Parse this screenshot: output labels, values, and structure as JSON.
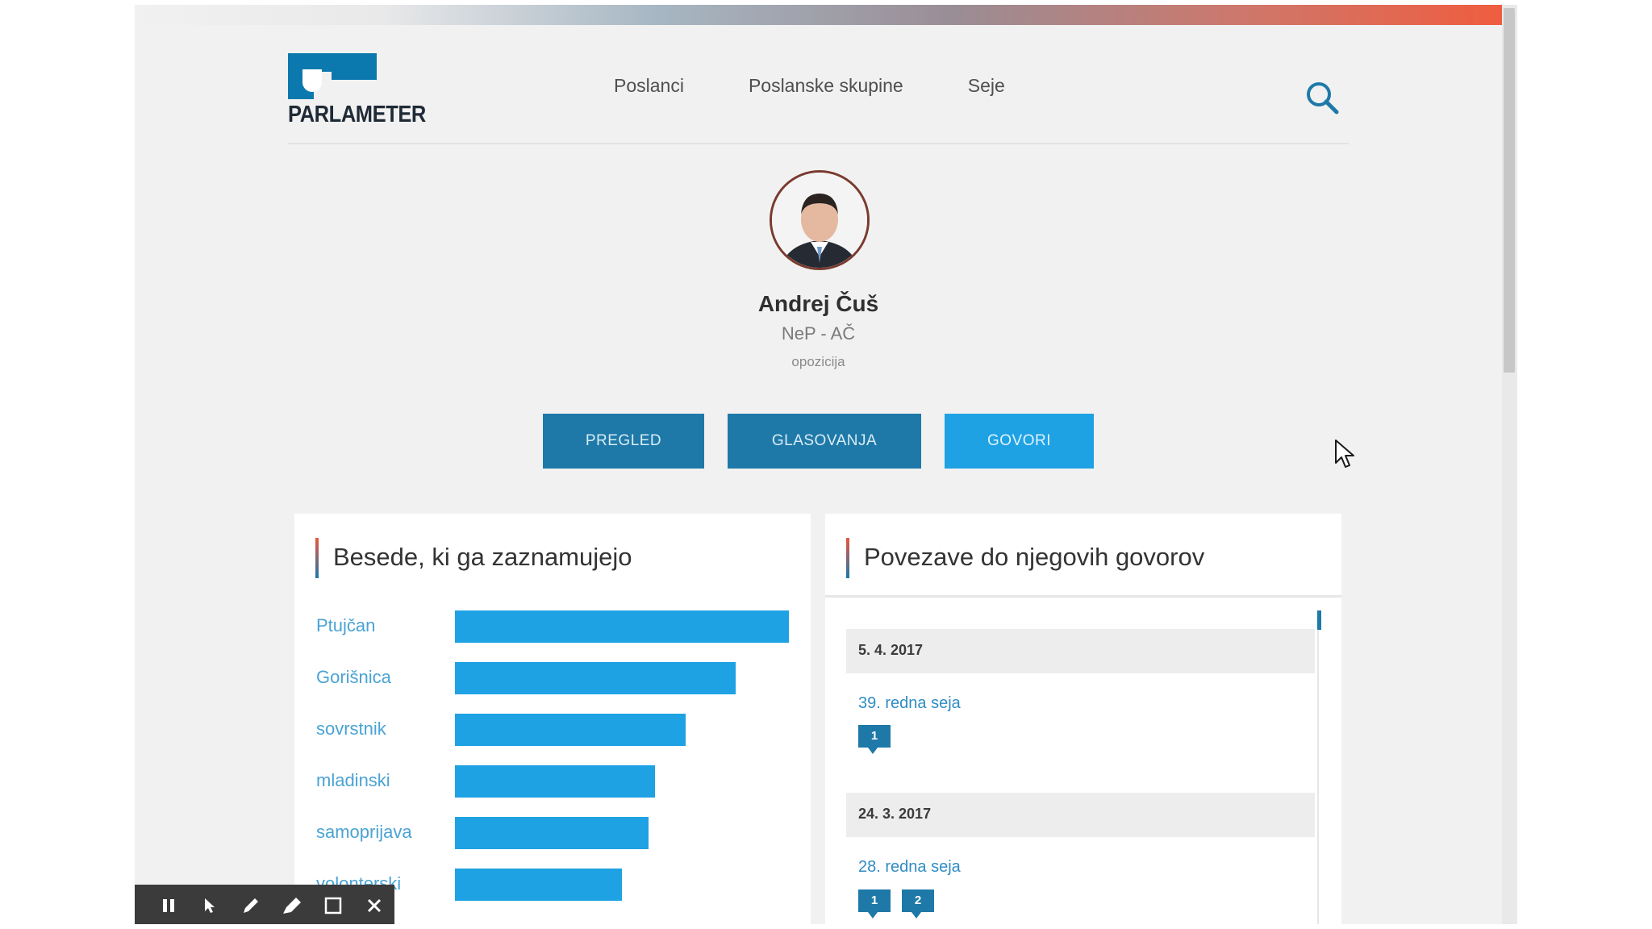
{
  "logo": {
    "text": "PARLAMETER"
  },
  "nav": {
    "items": [
      "Poslanci",
      "Poslanske skupine",
      "Seje"
    ]
  },
  "profile": {
    "name": "Andrej Čuš",
    "party": "NeP - AČ",
    "status": "opozicija"
  },
  "tabs": {
    "pregled": "PREGLED",
    "glasovanja": "GLASOVANJA",
    "govori": "GOVORI",
    "active": "GOVORI"
  },
  "words_card": {
    "title": "Besede, ki ga zaznamujejo",
    "items": [
      {
        "word": "Ptujčan",
        "value": 1.0
      },
      {
        "word": "Gorišnica",
        "value": 0.84
      },
      {
        "word": "sovrstnik",
        "value": 0.69
      },
      {
        "word": "mladinski",
        "value": 0.6
      },
      {
        "word": "samoprijava",
        "value": 0.58
      },
      {
        "word": "volonterski",
        "value": 0.5
      }
    ]
  },
  "links_card": {
    "title": "Povezave do njegovih govorov",
    "entries": [
      {
        "date": "5. 4. 2017",
        "session": "39. redna seja",
        "speeches": [
          "1"
        ]
      },
      {
        "date": "24. 3. 2017",
        "session": "28. redna seja",
        "speeches": [
          "1",
          "2"
        ]
      }
    ]
  },
  "colors": {
    "primary": "#1e79a8",
    "active_tab": "#1ea2e3",
    "accent": "#e9573f",
    "bar": "#1ea2e3"
  },
  "icons": [
    "search-icon",
    "pause-icon",
    "pointer-icon",
    "pen-icon",
    "marker-icon",
    "square-icon",
    "close-icon",
    "cursor-icon"
  ]
}
